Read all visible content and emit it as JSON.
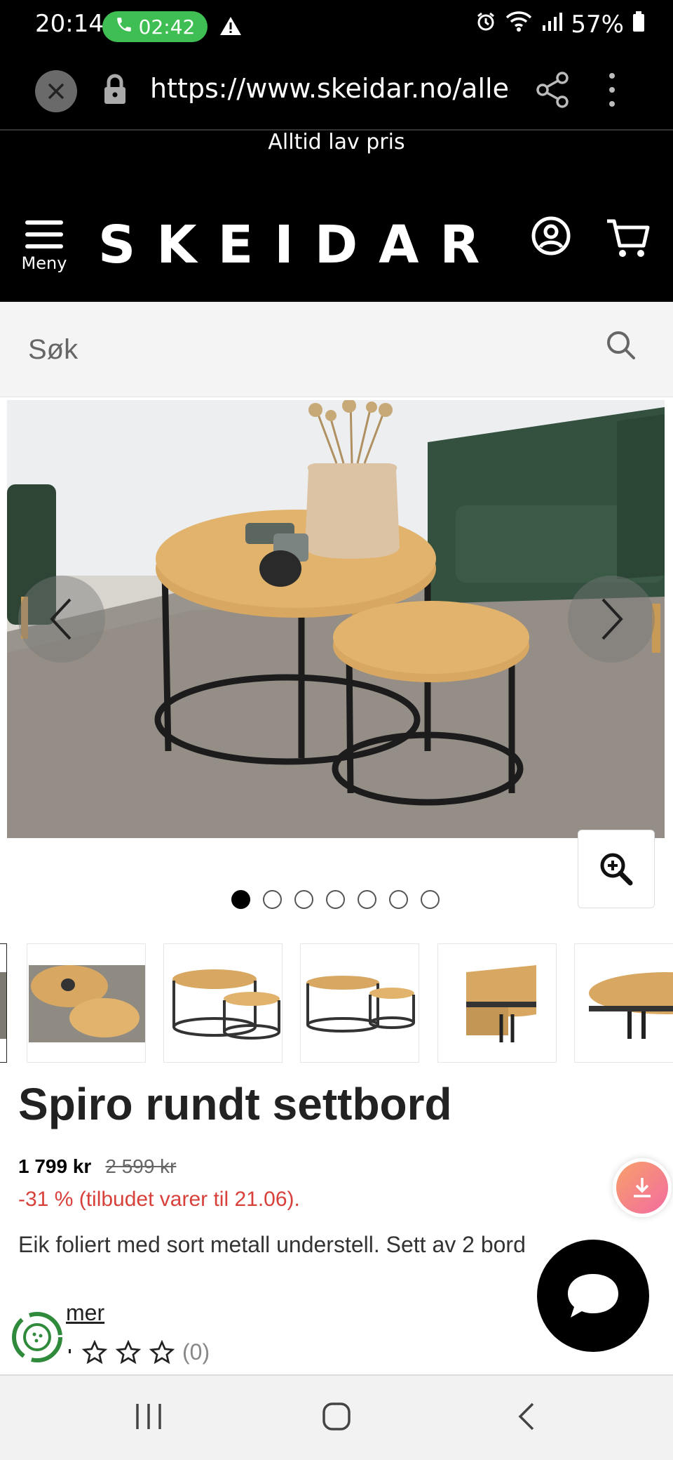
{
  "status_bar": {
    "time": "20:14",
    "call_duration": "02:42",
    "battery": "57%",
    "icons": [
      "phone-icon",
      "warning-icon",
      "alarm-icon",
      "wifi-icon",
      "signal-icon",
      "battery-icon"
    ]
  },
  "browser": {
    "url": "https://www.skeidar.no/alle-p"
  },
  "promo": {
    "text": "Alltid lav pris"
  },
  "header": {
    "menu_label": "Meny",
    "logo": "SKEIDAR"
  },
  "search": {
    "placeholder": "Søk"
  },
  "gallery": {
    "image_count": 7,
    "active_index": 0,
    "thumbnail_count": 6
  },
  "product": {
    "title": "Spiro rundt settbord",
    "price": "1 799 kr",
    "old_price": "2 599 kr",
    "discount": "-31 % (tilbudet varer til 21.06).",
    "description": "Eik foliert med sort metall understell. Sett av 2 bord",
    "read_more": "mer",
    "rating_count": "(0)",
    "rating_stars": 0
  },
  "colors": {
    "header_bg": "#000000",
    "discount": "#d8413b",
    "call_pill": "#3fbf53"
  }
}
